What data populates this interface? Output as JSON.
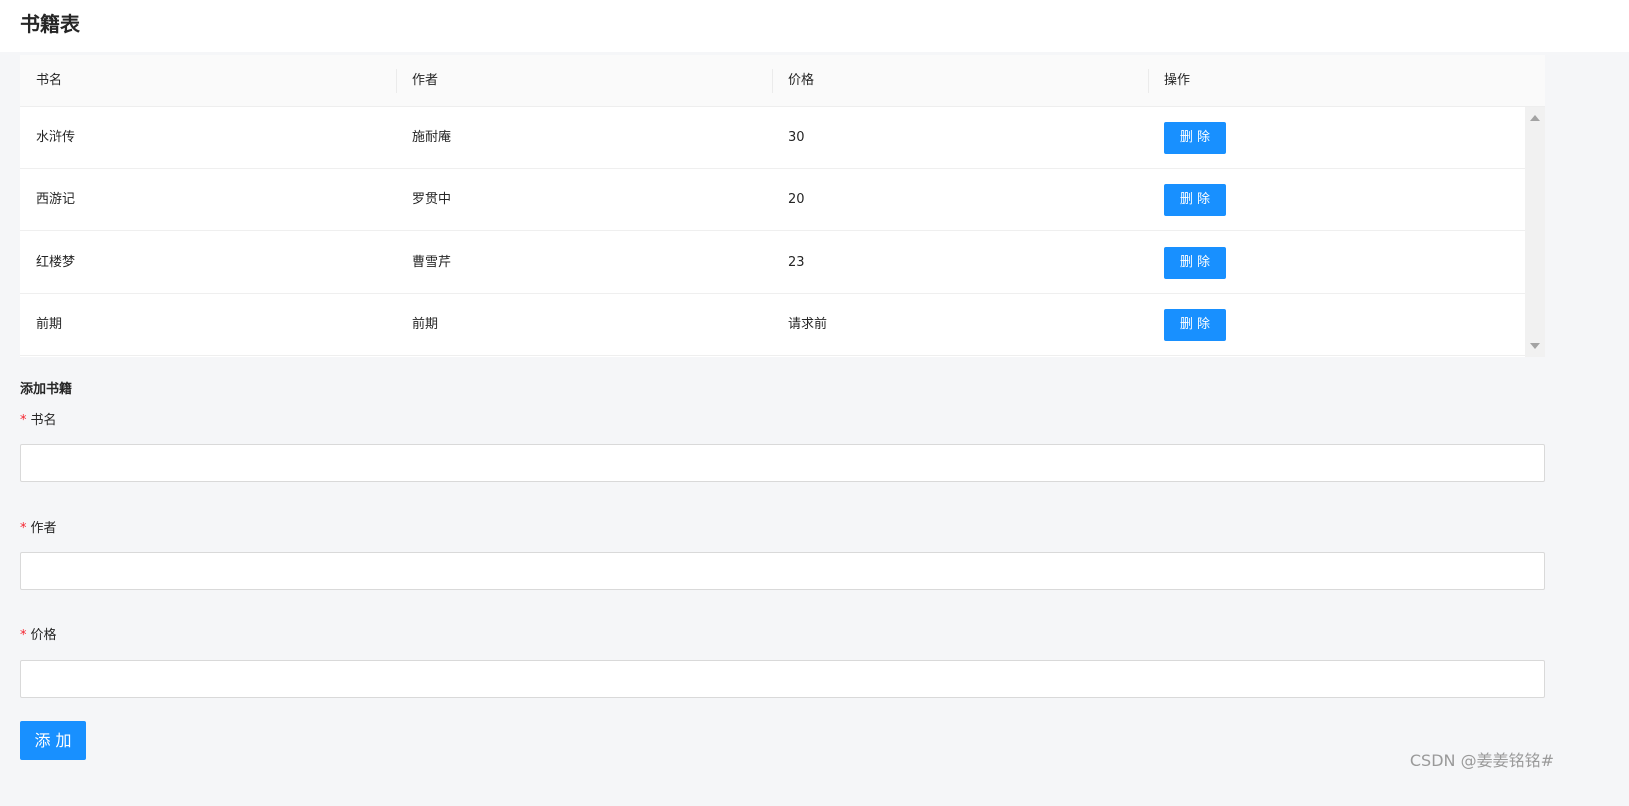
{
  "page": {
    "title": "书籍表"
  },
  "table": {
    "headers": [
      "书名",
      "作者",
      "价格",
      "操作"
    ],
    "rows": [
      {
        "name": "水浒传",
        "author": "施耐庵",
        "price": "30",
        "action": "删 除"
      },
      {
        "name": "西游记",
        "author": "罗贯中",
        "price": "20",
        "action": "删 除"
      },
      {
        "name": "红楼梦",
        "author": "曹雪芹",
        "price": "23",
        "action": "删 除"
      },
      {
        "name": "前期",
        "author": "前期",
        "price": "请求前",
        "action": "删 除"
      }
    ]
  },
  "form": {
    "heading": "添加书籍",
    "required_mark": "*",
    "fields": [
      {
        "label": "书名",
        "value": ""
      },
      {
        "label": "作者",
        "value": ""
      },
      {
        "label": "价格",
        "value": ""
      }
    ],
    "submit_label": "添 加"
  },
  "watermark": "CSDN @姜姜铭铭#",
  "colors": {
    "primary": "#1890ff",
    "required": "#f5222d"
  }
}
